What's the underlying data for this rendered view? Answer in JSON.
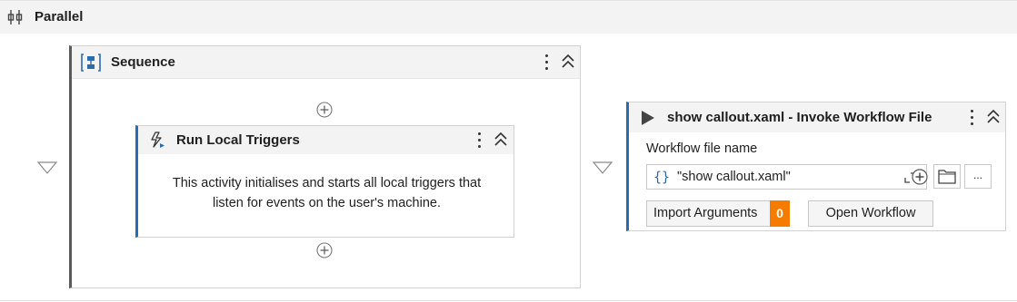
{
  "parallel": {
    "title": "Parallel",
    "icon": "parallel-icon"
  },
  "sequence": {
    "title": "Sequence",
    "icon": "sequence-icon"
  },
  "run_local_triggers": {
    "title": "Run Local Triggers",
    "icon": "trigger-icon",
    "description_line1": "This activity initialises and starts all local triggers that",
    "description_line2": "listen for events on the user's machine."
  },
  "invoke_workflow": {
    "title": "show callout.xaml - Invoke Workflow File",
    "icon": "play-icon",
    "file_label": "Workflow file name",
    "file_value": "\"show callout.xaml\"",
    "braces": "{}",
    "more_label": "...",
    "import_label": "Import Arguments",
    "import_count": "0",
    "open_label": "Open Workflow"
  },
  "colors": {
    "accent": "#2b6cb0",
    "badge": "#f57c00",
    "header_bg": "#f3f3f3"
  }
}
